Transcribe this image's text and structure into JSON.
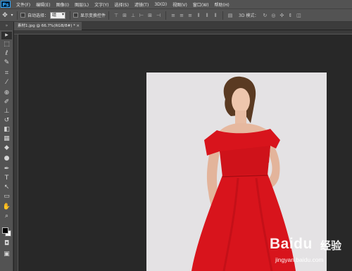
{
  "app": {
    "logo_text": "Ps"
  },
  "menu": [
    "文件(F)",
    "编辑(E)",
    "图像(I)",
    "图层(L)",
    "文字(Y)",
    "选择(S)",
    "滤镜(T)",
    "3D(D)",
    "视图(V)",
    "窗口(W)",
    "帮助(H)"
  ],
  "options": {
    "auto_select_label": "自动选择：",
    "auto_select_value": "组",
    "show_transform_label": "显示变换控件",
    "mode_3d_label": "3D 模式："
  },
  "document": {
    "tab_title": "素材1.jpg @ 66.7%(RGB/8#) *",
    "close_glyph": "×"
  },
  "tools": [
    "move-icon",
    "marquee-icon",
    "lasso-icon",
    "quick-select-icon",
    "crop-icon",
    "eyedropper-icon",
    "healing-icon",
    "brush-icon",
    "stamp-icon",
    "history-brush-icon",
    "eraser-icon",
    "gradient-icon",
    "blur-icon",
    "dodge-icon",
    "pen-icon",
    "type-icon",
    "path-select-icon",
    "shape-icon",
    "hand-icon",
    "zoom-icon"
  ],
  "colors": {
    "foreground": "#000000",
    "background": "#ffffff",
    "dress": "#d8141c",
    "backdrop": "#e4e2e4"
  },
  "watermark": {
    "brand": "Baidu",
    "cn": "经验",
    "url": "jingyan.baidu.com"
  }
}
